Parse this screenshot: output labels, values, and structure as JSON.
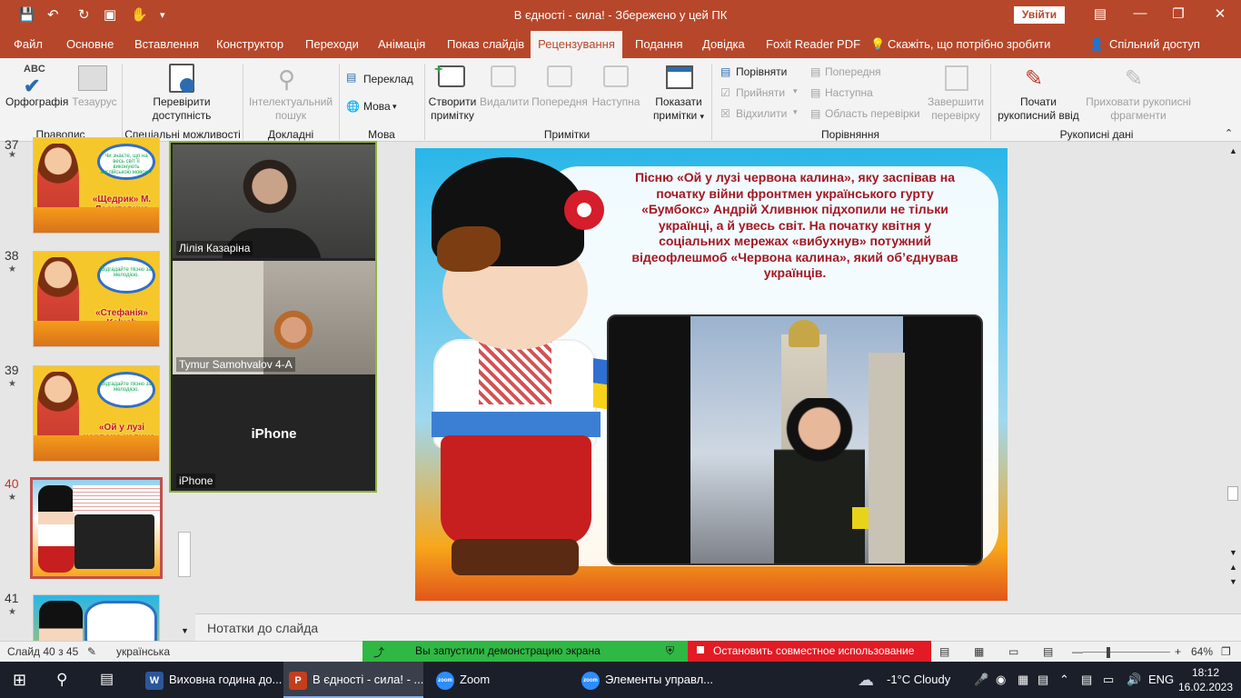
{
  "window": {
    "title": "В єдності - сила!  -  Збережено у цей ПК",
    "signin_label": "Увійти"
  },
  "tabs": [
    {
      "label": "Файл"
    },
    {
      "label": "Основне"
    },
    {
      "label": "Вставлення"
    },
    {
      "label": "Конструктор"
    },
    {
      "label": "Переходи"
    },
    {
      "label": "Анімація"
    },
    {
      "label": "Показ слайдів"
    },
    {
      "label": "Рецензування"
    },
    {
      "label": "Подання"
    },
    {
      "label": "Довідка"
    },
    {
      "label": "Foxit Reader PDF"
    },
    {
      "label": "Скажіть, що потрібно зробити"
    },
    {
      "label": "Спільний доступ"
    }
  ],
  "ribbon": {
    "spelling": "Орфографія",
    "thesaurus": "Тезаурус",
    "group_proofing": "Правопис",
    "check_access_1": "Перевірити",
    "check_access_2": "доступність",
    "group_access": "Спеціальні можливості",
    "smart_lookup_1": "Інтелектуальний",
    "smart_lookup_2": "пошук",
    "group_insights": "Докладні відомості",
    "translate": "Переклад",
    "language": "Мова",
    "group_language": "Мова",
    "new_comment_1": "Створити",
    "new_comment_2": "примітку",
    "delete": "Видалити",
    "previous": "Попередня",
    "next": "Наступна",
    "show_comments_1": "Показати",
    "show_comments_2": "примітки",
    "group_comments": "Примітки",
    "compare": "Порівняти",
    "accept": "Прийняти",
    "reject": "Відхилити",
    "prev_change": "Попередня",
    "next_change": "Наступна",
    "reviewing_pane": "Область перевірки",
    "end_review_1": "Завершити",
    "end_review_2": "перевірку",
    "group_compare": "Порівняння",
    "start_ink_1": "Почати",
    "start_ink_2": "рукописний ввід",
    "hide_ink_1": "Приховати рукописні",
    "hide_ink_2": "фрагменти",
    "group_ink": "Рукописні дані"
  },
  "thumbnails": [
    {
      "num": "37",
      "caption": "«Щедрик» М. Леонтовича",
      "bubble": "Чи знаєте, що на весь світ її виконують англійською мовою?"
    },
    {
      "num": "38",
      "caption": "«Стефанія» Kalush",
      "bubble": "Відгадайте пісню за мелодією."
    },
    {
      "num": "39",
      "caption": "«Ой у лузі червона калина» Бумбокс",
      "bubble": "Відгадайте пісню за мелодією."
    },
    {
      "num": "40",
      "caption": "",
      "bubble": ""
    },
    {
      "num": "41",
      "caption": "",
      "bubble": ""
    }
  ],
  "slide": {
    "text": "Пісню «Ой у лузі червона калина», яку заспівав на початку війни фронтмен українського гурту «Бумбокс» Андрій Хливнюк підхопили не тільки українці, а й увесь світ. На початку квітня у соціальних мережах «вибухнув» потужний відеофлешмоб «Червона калина», який об’єднував українців."
  },
  "zoom": {
    "participants": [
      {
        "name": "Лілія Казаріна"
      },
      {
        "name": "Tymur Samohvalov 4-A"
      },
      {
        "name": "iPhone",
        "center_label": "iPhone"
      }
    ]
  },
  "notes": {
    "placeholder": "Нотатки до слайда"
  },
  "status": {
    "slide_info": "Слайд 40 з 45",
    "language": "українська",
    "zoom_pct": "64%",
    "share_msg": "Вы запустили демонстрацию экрана",
    "stop_msg": "Остановить совместное использование"
  },
  "taskbar": {
    "items": [
      {
        "label": "Виховна година до..."
      },
      {
        "label": "В єдності - сила! - ..."
      },
      {
        "label": "Zoom"
      },
      {
        "label": "Элементы управл..."
      }
    ],
    "weather": "-1°C  Cloudy",
    "lang": "ENG",
    "time": "18:12",
    "date": "16.02.2023"
  },
  "colors": {
    "accent": "#b7472a",
    "share_green": "#2fb843",
    "stop_red": "#e21b24"
  }
}
